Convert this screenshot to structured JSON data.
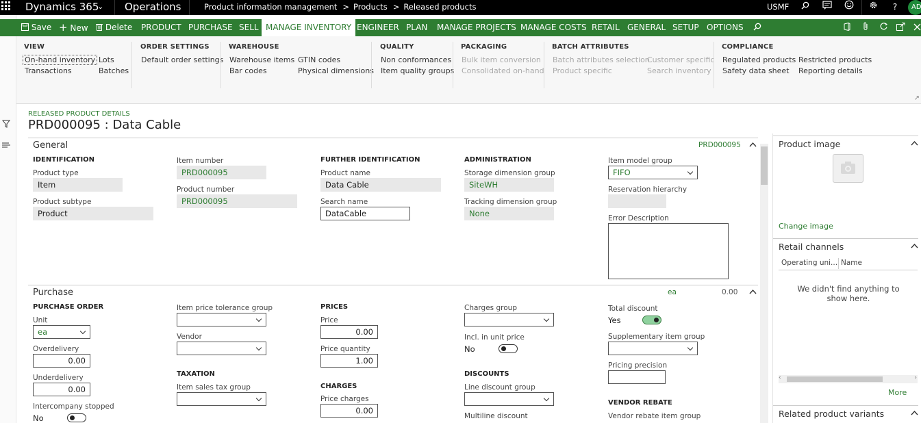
{
  "topbar": {
    "app_name": "Dynamics 365",
    "module": "Operations",
    "breadcrumb": [
      "Product information management",
      "Products",
      "Released products"
    ],
    "company": "USMF",
    "avatar_initials": "AD",
    "icons": [
      "search-icon",
      "message-icon",
      "smiley-icon",
      "gear-icon",
      "help-icon"
    ]
  },
  "actionbar": {
    "save": "Save",
    "new": "New",
    "delete": "Delete",
    "tabs": [
      "PRODUCT",
      "PURCHASE",
      "SELL",
      "MANAGE INVENTORY",
      "ENGINEER",
      "PLAN",
      "MANAGE PROJECTS",
      "MANAGE COSTS",
      "RETAIL",
      "GENERAL",
      "SETUP",
      "OPTIONS"
    ],
    "active_tab": "MANAGE INVENTORY"
  },
  "ribbon": {
    "view": {
      "title": "VIEW",
      "items": [
        "On-hand inventory",
        "Transactions",
        "Lots",
        "Batches"
      ]
    },
    "order_settings": {
      "title": "ORDER SETTINGS",
      "items": [
        "Default order settings"
      ]
    },
    "warehouse": {
      "title": "WAREHOUSE",
      "items": [
        "Warehouse items",
        "Bar codes",
        "GTIN codes",
        "Physical dimensions"
      ]
    },
    "quality": {
      "title": "QUALITY",
      "items": [
        "Non conformances",
        "Item quality groups"
      ]
    },
    "packaging": {
      "title": "PACKAGING",
      "items": [
        "Bulk item conversion",
        "Consolidated on-hand"
      ]
    },
    "batch_attributes": {
      "title": "BATCH ATTRIBUTES",
      "items": [
        "Batch attributes selection",
        "Product specific",
        "Customer specific",
        "Search inventory"
      ]
    },
    "compliance": {
      "title": "COMPLIANCE",
      "items": [
        "Regulated products",
        "Safety data sheet",
        "Restricted products",
        "Reporting details"
      ]
    }
  },
  "page": {
    "caption": "RELEASED PRODUCT DETAILS",
    "title": "PRD000095 : Data Cable"
  },
  "general": {
    "title": "General",
    "summary": "PRD000095",
    "identification": {
      "title": "IDENTIFICATION",
      "product_type_label": "Product type",
      "product_type": "Item",
      "product_subtype_label": "Product subtype",
      "product_subtype": "Product",
      "item_number_label": "Item number",
      "item_number": "PRD000095",
      "product_number_label": "Product number",
      "product_number": "PRD000095"
    },
    "further_identification": {
      "title": "FURTHER IDENTIFICATION",
      "product_name_label": "Product name",
      "product_name": "Data Cable",
      "search_name_label": "Search name",
      "search_name": "DataCable"
    },
    "administration": {
      "title": "ADMINISTRATION",
      "storage_label": "Storage dimension group",
      "storage": "SiteWH",
      "tracking_label": "Tracking dimension group",
      "tracking": "None",
      "item_model_group_label": "Item model group",
      "item_model_group": "FIFO",
      "reservation_label": "Reservation hierarchy",
      "reservation": "",
      "error_label": "Error Description",
      "error": ""
    }
  },
  "purchase": {
    "title": "Purchase",
    "summary_unit": "ea",
    "summary_price": "0.00",
    "purchase_order": {
      "title": "PURCHASE ORDER",
      "unit_label": "Unit",
      "unit": "ea",
      "overdelivery_label": "Overdelivery",
      "overdelivery": "0.00",
      "underdelivery_label": "Underdelivery",
      "underdelivery": "0.00",
      "intercompany_label": "Intercompany stopped",
      "intercompany": "No"
    },
    "price_tolerance_label": "Item price tolerance group",
    "price_tolerance": "",
    "vendor_label": "Vendor",
    "vendor": "",
    "taxation": {
      "title": "TAXATION",
      "tax_group_label": "Item sales tax group",
      "tax_group": ""
    },
    "prices": {
      "title": "PRICES",
      "price_label": "Price",
      "price": "0.00",
      "price_qty_label": "Price quantity",
      "price_qty": "1.00"
    },
    "charges": {
      "title": "CHARGES",
      "price_charges_label": "Price charges",
      "price_charges": "0.00"
    },
    "charges_group_label": "Charges group",
    "charges_group": "",
    "incl_unit_price_label": "Incl. in unit price",
    "incl_unit_price": "No",
    "discounts": {
      "title": "DISCOUNTS",
      "line_discount_label": "Line discount group",
      "line_discount": "",
      "multiline_label": "Multiline discount"
    },
    "total_discount_label": "Total discount",
    "total_discount": "Yes",
    "supplementary_label": "Supplementary item group",
    "supplementary": "",
    "pricing_precision_label": "Pricing precision",
    "pricing_precision": "",
    "vendor_rebate": {
      "title": "VENDOR REBATE",
      "group_label": "Vendor rebate item group"
    }
  },
  "factbox": {
    "product_image_title": "Product image",
    "change_image": "Change image",
    "retail_channels_title": "Retail channels",
    "col_operating_unit": "Operating uni...",
    "col_name": "Name",
    "empty_message": "We didn't find anything to show here.",
    "more": "More",
    "related_variants_title": "Related product variants"
  }
}
